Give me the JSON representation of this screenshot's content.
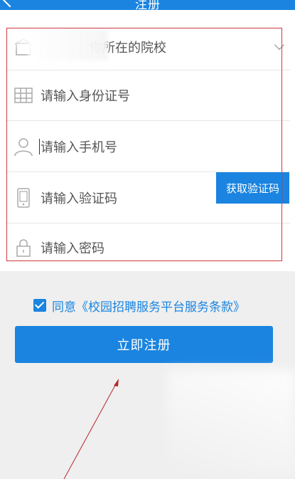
{
  "header": {
    "title": "注册"
  },
  "form": {
    "school_placeholder": "你所在的院校",
    "id_placeholder": "请输入身份证号",
    "phone_placeholder": "请输入手机号",
    "code_placeholder": "请输入验证码",
    "get_code_label": "获取验证码",
    "password_placeholder": "请输入密码"
  },
  "agreement": {
    "checked": true,
    "text": "同意《校园招聘服务平台服务条款》"
  },
  "register_label": "立即注册",
  "colors": {
    "primary": "#1a84e0",
    "highlight_box": "#d0393e",
    "annotation_arrow": "#b5282c"
  },
  "icons": {
    "school": "school-icon",
    "id": "id-card-icon",
    "phone": "user-icon",
    "code": "phone-icon",
    "password": "lock-icon"
  }
}
